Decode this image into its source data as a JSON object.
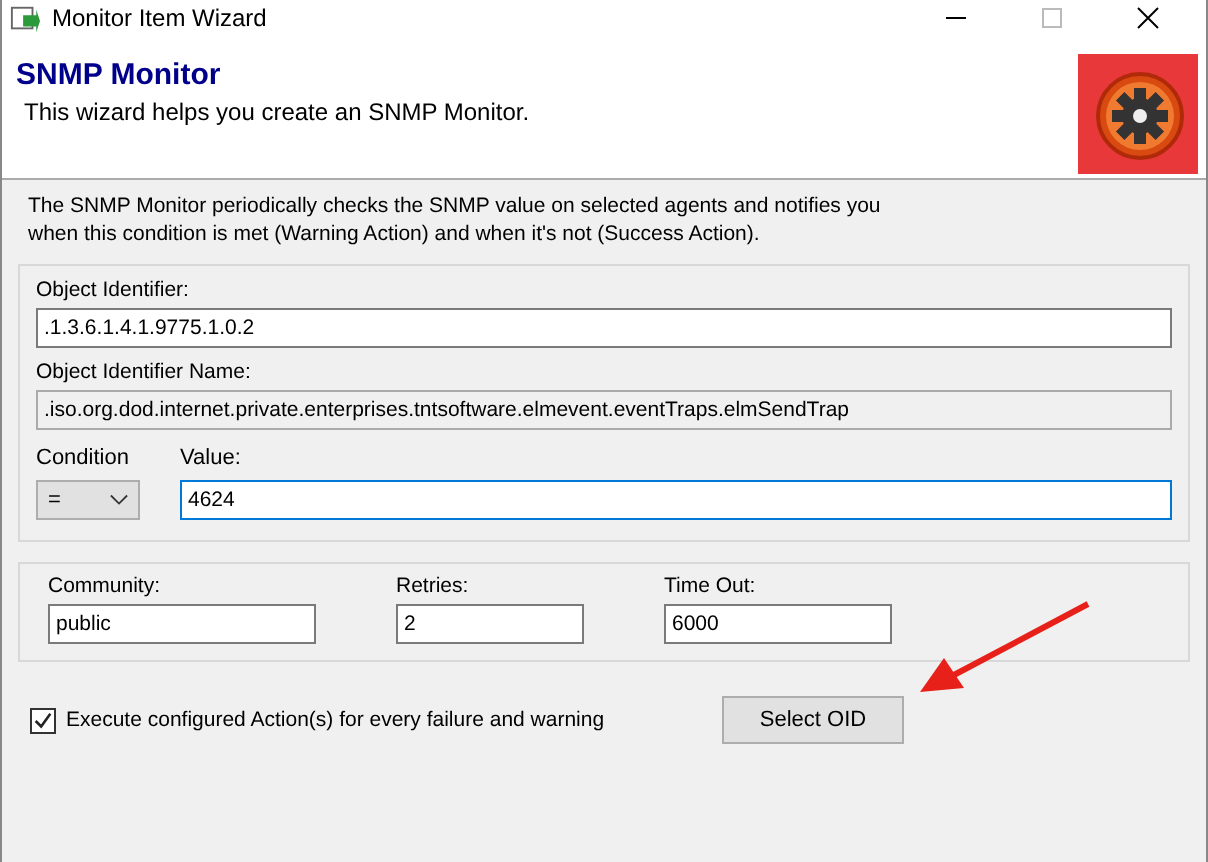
{
  "window": {
    "title": "Monitor Item Wizard"
  },
  "header": {
    "title": "SNMP Monitor",
    "subtitle": "This wizard helps you create an SNMP Monitor."
  },
  "description": "The SNMP Monitor periodically checks the SNMP value on selected agents and notifies you when this condition is met (Warning Action) and when it's not (Success Action).",
  "object_identifier": {
    "label": "Object Identifier:",
    "value": ".1.3.6.1.4.1.9775.1.0.2",
    "disabled": false
  },
  "object_identifier_name": {
    "label": "Object Identifier Name:",
    "value": ".iso.org.dod.internet.private.enterprises.tntsoftware.elmevent.eventTraps.elmSendTrap",
    "disabled": true
  },
  "condition": {
    "label": "Condition",
    "value": "="
  },
  "value_field": {
    "label": "Value:",
    "value": "4624",
    "focused": true
  },
  "settings": [
    {
      "label": "Community:",
      "value": "public"
    },
    {
      "label": "Retries:",
      "value": "2"
    },
    {
      "label": "Time Out:",
      "value": "6000"
    }
  ],
  "execute_checkbox": {
    "label": "Execute configured Action(s) for every failure and warning",
    "checked": true
  },
  "select_button": {
    "label": "Select OID"
  }
}
